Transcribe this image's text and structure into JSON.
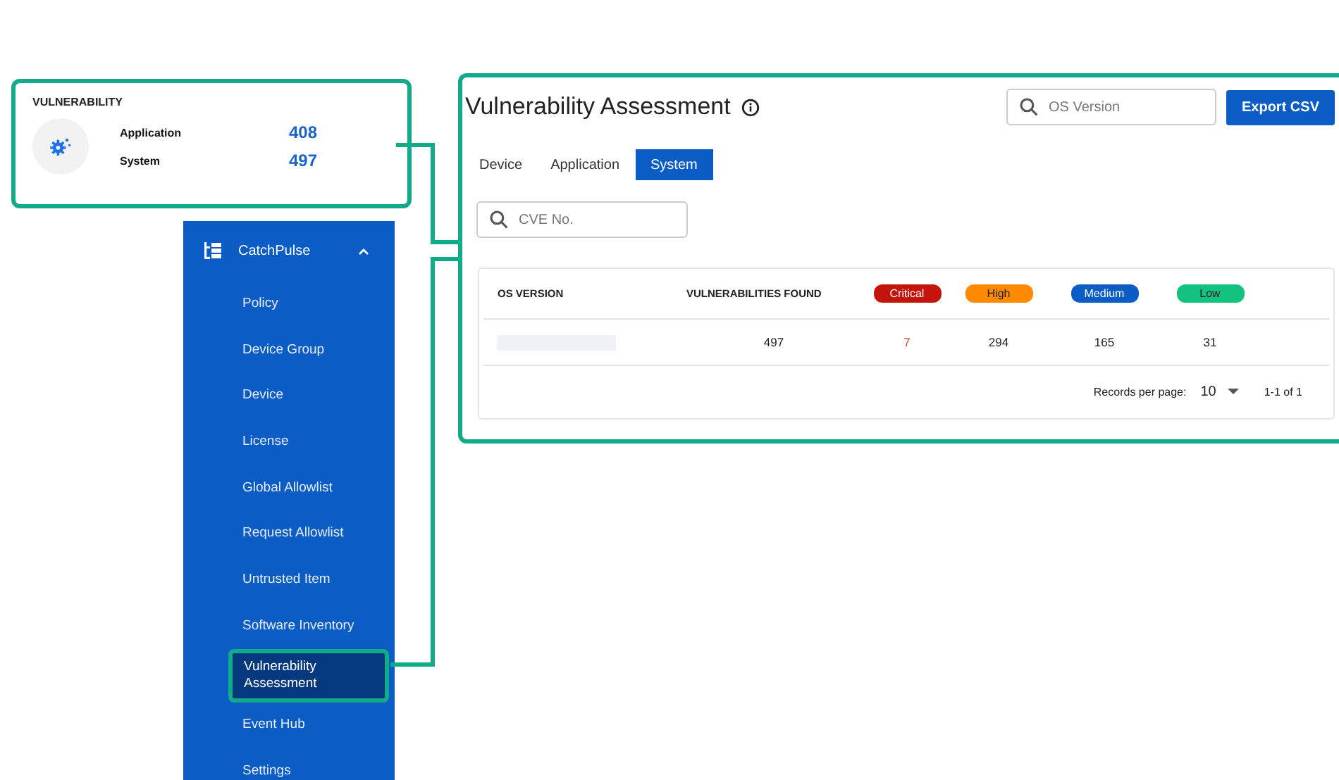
{
  "summary_card": {
    "title": "VULNERABILITY",
    "stats": [
      {
        "label": "Application",
        "value": "408"
      },
      {
        "label": "System",
        "value": "497"
      }
    ]
  },
  "sidebar": {
    "group": {
      "label": "CatchPulse",
      "expanded": true
    },
    "items": [
      {
        "label": "Policy",
        "selected": false
      },
      {
        "label": "Device Group",
        "selected": false
      },
      {
        "label": "Device",
        "selected": false
      },
      {
        "label": "License",
        "selected": false
      },
      {
        "label": "Global Allowlist",
        "selected": false
      },
      {
        "label": "Request Allowlist",
        "selected": false
      },
      {
        "label": "Untrusted Item",
        "selected": false
      },
      {
        "label": "Software Inventory",
        "selected": false
      },
      {
        "label": "Vulnerability Assessment",
        "selected": true
      },
      {
        "label": "Event Hub",
        "selected": false
      },
      {
        "label": "Settings",
        "selected": false
      }
    ]
  },
  "panel": {
    "title": "Vulnerability Assessment",
    "search": {
      "placeholder": "OS Version"
    },
    "export_button": "Export CSV",
    "tabs": [
      {
        "label": "Device",
        "selected": false
      },
      {
        "label": "Application",
        "selected": false
      },
      {
        "label": "System",
        "selected": true
      }
    ],
    "cve_search": {
      "placeholder": "CVE No."
    },
    "table": {
      "columns": [
        {
          "kind": "text",
          "label": "OS VERSION"
        },
        {
          "kind": "text",
          "label": "VULNERABILITIES FOUND"
        },
        {
          "kind": "badge",
          "label": "Critical",
          "color": "#c4150c"
        },
        {
          "kind": "badge",
          "label": "High",
          "color": "#ff8a00"
        },
        {
          "kind": "badge",
          "label": "Medium",
          "color": "#0b5cc4"
        },
        {
          "kind": "badge",
          "label": "Low",
          "color": "#12c27e"
        }
      ],
      "rows": [
        {
          "cells": [
            {
              "kind": "redacted"
            },
            {
              "kind": "text",
              "text": "497"
            },
            {
              "kind": "text",
              "text": "7",
              "alert": true
            },
            {
              "kind": "text",
              "text": "294"
            },
            {
              "kind": "text",
              "text": "165"
            },
            {
              "kind": "text",
              "text": "31"
            }
          ]
        }
      ]
    },
    "pagination": {
      "label": "Records per page:",
      "per_page": "10",
      "range": "1-1 of 1"
    }
  }
}
